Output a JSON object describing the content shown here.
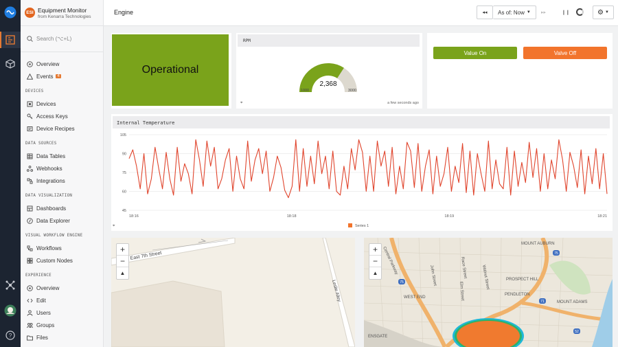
{
  "app": {
    "name": "Equipment Monitor",
    "subtitle": "from Kenarra Technologies",
    "badge": "ESI"
  },
  "search": {
    "placeholder": "Search (⌥+L)"
  },
  "nav": {
    "top": [
      {
        "label": "Overview",
        "icon": "overview-icon"
      },
      {
        "label": "Events",
        "icon": "events-icon",
        "badge": "4"
      }
    ],
    "devices_title": "DEVICES",
    "devices": [
      {
        "label": "Devices"
      },
      {
        "label": "Access Keys"
      },
      {
        "label": "Device Recipes"
      }
    ],
    "datasources_title": "DATA SOURCES",
    "datasources": [
      {
        "label": "Data Tables"
      },
      {
        "label": "Webhooks"
      },
      {
        "label": "Integrations"
      }
    ],
    "viz_title": "DATA VISUALIZATION",
    "viz": [
      {
        "label": "Dashboards"
      },
      {
        "label": "Data Explorer"
      }
    ],
    "workflow_title": "VISUAL WORKFLOW ENGINE",
    "workflow": [
      {
        "label": "Workflows"
      },
      {
        "label": "Custom Nodes"
      }
    ],
    "experience_title": "EXPERIENCE",
    "experience": [
      {
        "label": "Overview"
      },
      {
        "label": "Edit"
      },
      {
        "label": "Users"
      },
      {
        "label": "Groups"
      },
      {
        "label": "Files"
      }
    ]
  },
  "header": {
    "title": "Engine",
    "rewind": "◂◂",
    "asof": "As of: Now",
    "forward": "▸▸",
    "pause": "❙❙"
  },
  "status": {
    "text": "Operational",
    "color": "#7aa31b"
  },
  "rpm": {
    "title": "RPM",
    "value": "2,368",
    "min": "1000",
    "max": "3000",
    "fill": 0.684,
    "updated": "a few seconds ago"
  },
  "valves": {
    "on": "Value On",
    "off": "Valve Off",
    "on_color": "#7aa31b",
    "off_color": "#f2742c"
  },
  "chart_title": "Internal Temperature",
  "chart_data": {
    "type": "line",
    "title": "Internal Temperature",
    "ylim": [
      45,
      105
    ],
    "yticks": [
      45,
      60,
      75,
      90,
      105
    ],
    "xticks": [
      "18:16",
      "18:18",
      "18:19",
      "18:21"
    ],
    "legend": "Series 1",
    "color": "#e0442c",
    "values": [
      86,
      93,
      80,
      62,
      90,
      58,
      70,
      95,
      78,
      62,
      91,
      70,
      57,
      95,
      68,
      82,
      74,
      58,
      101,
      85,
      64,
      100,
      80,
      95,
      62,
      70,
      85,
      94,
      60,
      88,
      70,
      62,
      100,
      68,
      85,
      94,
      74,
      92,
      60,
      71,
      88,
      79,
      61,
      55,
      64,
      101,
      60,
      94,
      64,
      88,
      66,
      100,
      74,
      88,
      62,
      92,
      60,
      57,
      80,
      62,
      94,
      77,
      101,
      91,
      60,
      88,
      60,
      100,
      80,
      92,
      64,
      95,
      58,
      80,
      62,
      99,
      92,
      63,
      98,
      60,
      80,
      93,
      58,
      88,
      64,
      74,
      95,
      60,
      80,
      67,
      98,
      59,
      92,
      57,
      90,
      74,
      60,
      100,
      62,
      85,
      66,
      62,
      95,
      57,
      92,
      64,
      83,
      67,
      99,
      71,
      94,
      60,
      90,
      62,
      85,
      70,
      101,
      85,
      60,
      91,
      80,
      63,
      93,
      58,
      88,
      66,
      94,
      62,
      90,
      58
    ]
  },
  "map1": {
    "streets": [
      "East 7th Street",
      "Leslie Alley"
    ]
  },
  "map2": {
    "labels": [
      "Central Parkway",
      "John Street",
      "Race Street",
      "Elm Street",
      "Walnut Street",
      "WEST END",
      "PENDLETON",
      "PROSPECT HILL",
      "MOUNT AUBURN",
      "MOUNT ADAMS",
      "ENSGATE",
      "75",
      "71",
      "52"
    ]
  }
}
